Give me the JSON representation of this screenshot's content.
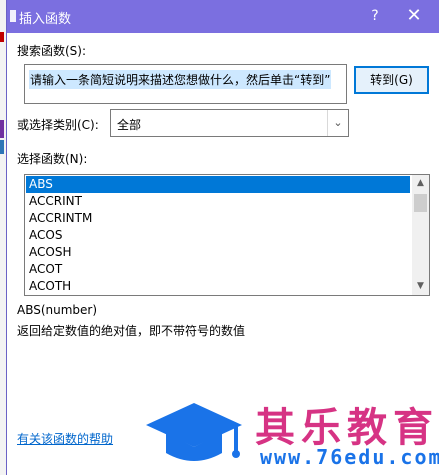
{
  "window": {
    "title": "插入函数",
    "help_symbol": "?",
    "close_symbol": "✕"
  },
  "search": {
    "label": "搜索函数(S):",
    "description": "请输入一条简短说明来描述您想做什么，然后单击“转到”",
    "goto_label": "转到(G)"
  },
  "category": {
    "label": "或选择类别(C):",
    "selected": "全部"
  },
  "functions": {
    "label": "选择函数(N):",
    "items": [
      "ABS",
      "ACCRINT",
      "ACCRINTM",
      "ACOS",
      "ACOSH",
      "ACOT",
      "ACOTH"
    ],
    "selected_index": 0,
    "signature": "ABS(number)",
    "description": "返回给定数值的绝对值，即不带符号的数值"
  },
  "help_link": "有关该函数的帮助",
  "watermark": {
    "name": "其乐教育",
    "url": "www.76edu.com"
  },
  "colors": {
    "titlebar": "#7b6fe0",
    "selection": "#0078d7",
    "link": "#0066cc",
    "watermark_name": "#d63384",
    "watermark_url": "#1a73e8"
  }
}
